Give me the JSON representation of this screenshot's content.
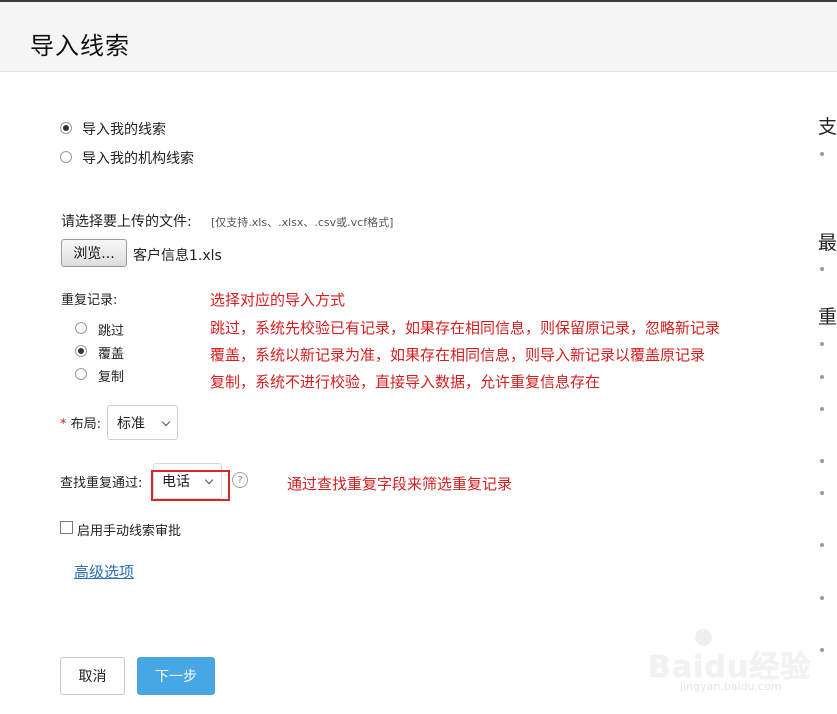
{
  "header": {
    "title": "导入线索"
  },
  "import_scope": {
    "options": [
      {
        "label": "导入我的线索",
        "checked": true
      },
      {
        "label": "导入我的机构线索",
        "checked": false
      }
    ]
  },
  "file": {
    "label": "请选择要上传的文件:",
    "hint": "[仅支持.xls、.xlsx、.csv或.vcf格式]",
    "browse_label": "浏览...",
    "filename": "客户信息1.xls"
  },
  "duplicates": {
    "label": "重复记录:",
    "options": [
      {
        "label": "跳过",
        "checked": false
      },
      {
        "label": "覆盖",
        "checked": true
      },
      {
        "label": "复制",
        "checked": false
      }
    ]
  },
  "annotations": {
    "line1": "选择对应的导入方式",
    "line2": "跳过，系统先校验已有记录，如果存在相同信息，则保留原记录，忽略新记录",
    "line3": "覆盖，系统以新记录为准，如果存在相同信息，则导入新记录以覆盖原记录",
    "line4": "复制，系统不进行校验，直接导入数据，允许重复信息存在",
    "lookup_note": "通过查找重复字段来筛选重复记录"
  },
  "layout_field": {
    "required_mark": "*",
    "label": "布局:",
    "value": "标准"
  },
  "lookup": {
    "label": "查找重复通过:",
    "value": "电话",
    "help_icon": "?"
  },
  "manual_approval": {
    "label": "启用手动线索审批",
    "checked": false
  },
  "advanced_link": "高级选项",
  "actions": {
    "cancel": "取消",
    "next": "下一步"
  },
  "side_panel": {
    "heads": [
      "支",
      "最",
      "重"
    ]
  },
  "watermark": {
    "text": "Baidu经验",
    "url": "jingyan.baidu.com"
  },
  "colors": {
    "accent": "#45a7e4",
    "annotation": "#d42020",
    "link": "#2b6fb5"
  }
}
